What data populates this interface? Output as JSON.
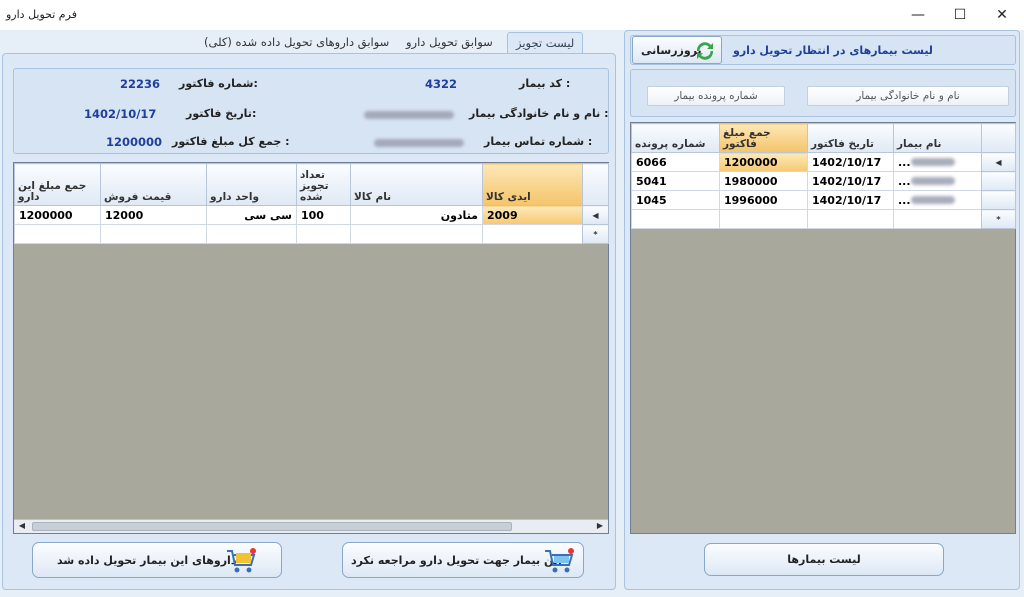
{
  "window": {
    "title": "فرم تحویل دارو"
  },
  "tabs": [
    {
      "label": "لیست تجویز",
      "active": true
    },
    {
      "label": "سوابق تحویل دارو",
      "active": false
    },
    {
      "label": "سوابق داروهای تحویل داده شده (کلی)",
      "active": false
    }
  ],
  "invoice": {
    "patient_code_label": "کد بیمار :",
    "patient_code": "4322",
    "invoice_number_label": "شماره فاکتور:",
    "invoice_number": "22236",
    "patient_name_label": "نام و نام خانوادگی بیمار :",
    "invoice_date_label": "تاریخ فاکتور:",
    "invoice_date": "1402/10/17",
    "patient_phone_label": "شماره تماس بیمار :",
    "invoice_total_label": "جمع کل مبلغ فاکتور :",
    "invoice_total": "1200000"
  },
  "prescription_grid": {
    "columns": [
      "ایدی کالا",
      "نام کالا",
      "تعداد تجویز شده",
      "واحد دارو",
      "قیمت فروش",
      "جمع مبلغ این دارو"
    ],
    "rows": [
      {
        "item_id": "2009",
        "item_name": "متادون",
        "qty": "100",
        "unit": "سی سی",
        "price": "12000",
        "total": "1200000"
      }
    ],
    "new_row_marker": "*"
  },
  "left_buttons": {
    "not_visited": "این بیمار جهت تحویل دارو مراجعه نکرد",
    "delivered": "داروهای این بیمار تحویل داده شد"
  },
  "right_panel": {
    "header": "لیست بیمارهای در انتظار تحویل دارو",
    "refresh_label": "بروزرسانی",
    "name_filter": "نام و نام خانوادگی بیمار",
    "file_filter": "شماره پرونده بیمار",
    "patients_button": "لیست بیمارها"
  },
  "waiting_grid": {
    "columns": [
      "نام بیمار",
      "تاریخ فاکتور",
      "جمع مبلغ فاکتور",
      "شماره پرونده"
    ],
    "rows": [
      {
        "name": "...",
        "date": "1402/10/17",
        "total": "1200000",
        "file": "6066"
      },
      {
        "name": "...",
        "date": "1402/10/17",
        "total": "1980000",
        "file": "5041"
      },
      {
        "name": "...",
        "date": "1402/10/17",
        "total": "1996000",
        "file": "1045"
      }
    ],
    "new_row_marker": "*"
  },
  "icons": {
    "minimize": "minimize-icon",
    "maximize": "maximize-icon",
    "close": "close-icon",
    "refresh": "refresh-icon",
    "cart": "shopping-cart-icon"
  },
  "colors": {
    "form_bg": "#e6eef8",
    "value_blue": "#1f3f9a",
    "highlight": "#f6c872",
    "grid_empty": "#a8a89c"
  }
}
